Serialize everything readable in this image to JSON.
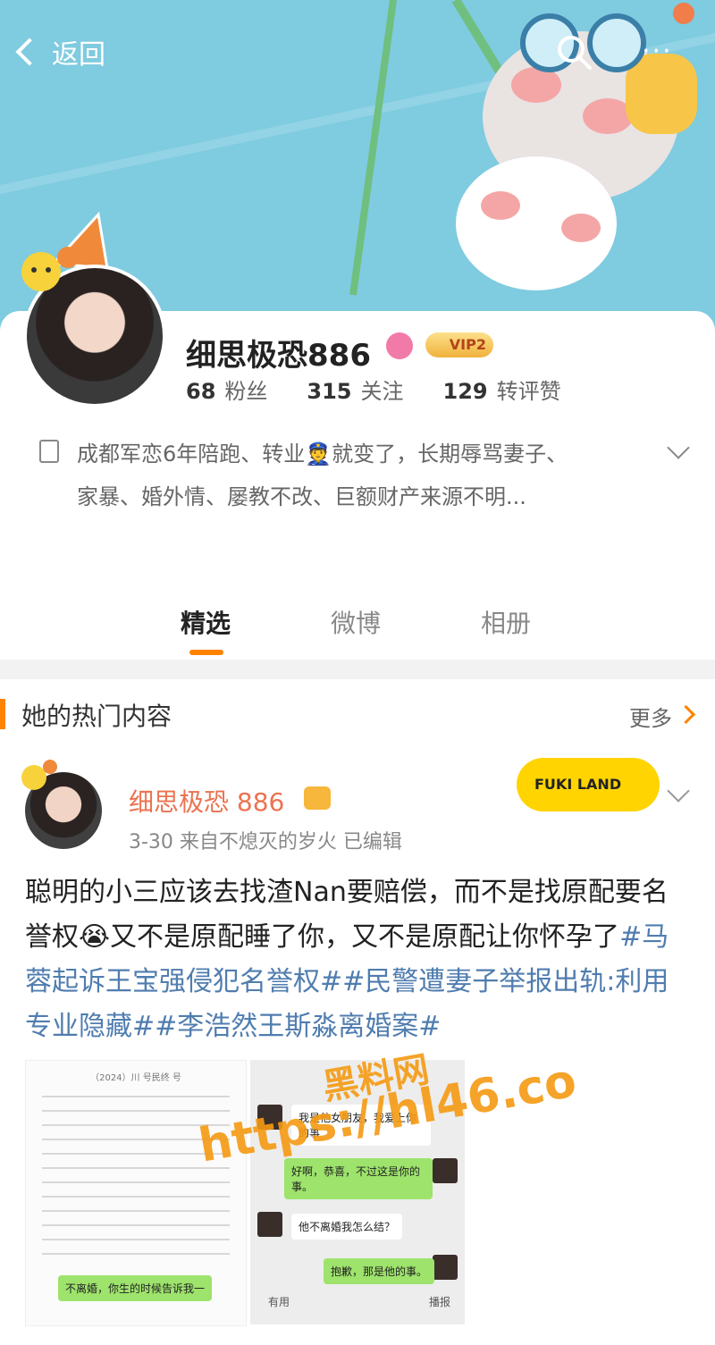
{
  "nav": {
    "back_label": "返回",
    "more": "···"
  },
  "profile": {
    "nickname": "细思极恐886",
    "vip": "VIP2",
    "stats": [
      {
        "value": "68",
        "label": "粉丝"
      },
      {
        "value": "315",
        "label": "关注"
      },
      {
        "value": "129",
        "label": "转评赞"
      }
    ],
    "bio": "成都军恋6年陪跑、转业👮就变了，长期辱骂妻子、家暴、婚外情、屡教不改、巨额财产来源不明..."
  },
  "tabs": [
    "精选",
    "微博",
    "相册"
  ],
  "hot": {
    "title": "她的热门内容",
    "more": "更多"
  },
  "post": {
    "author": "细思极恐 886",
    "meta": "3-30  来自不熄灭的岁火  已编辑",
    "badge": "FUKI LAND",
    "text_plain": "聪明的小三应该去找渣Nan要赔偿，而不是找原配要名誉权😭又不是原配睡了你，又不是原配让你怀孕了",
    "text_tags": "#马蓉起诉王宝强侵犯名誉权##民警遭妻子举报出轨:利用专业隐藏##李浩然王斯淼离婚案#"
  },
  "chat": {
    "b1": "我是他女朋友，我爱上你的事",
    "b2": "好啊，恭喜，不过这是你的事。",
    "b3": "他不离婚我怎么结？",
    "b4": "抱歉，那是他的事。",
    "b5": "不离婚，你生的时候告诉我一",
    "like": "有用",
    "report": "播报"
  },
  "doc": {
    "header": "（2024）川 号民终 号"
  },
  "watermark": {
    "line1": "黑料网",
    "line2": "https://hl46.co"
  }
}
